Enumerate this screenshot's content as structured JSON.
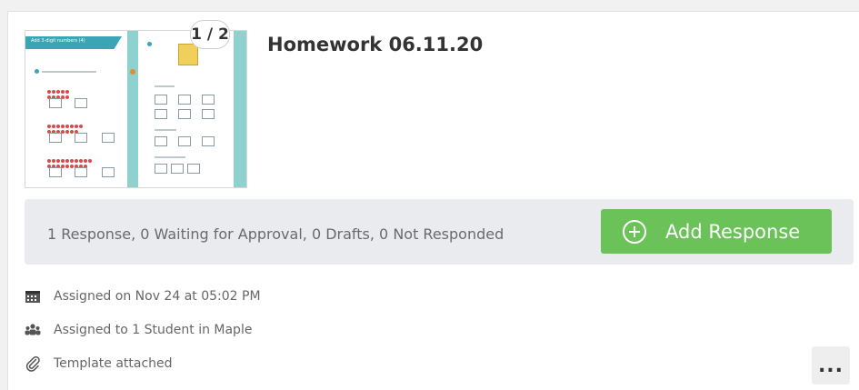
{
  "assignment": {
    "title": "Homework 06.11.20",
    "page_indicator": "1 / 2",
    "thumbnail": {
      "left_page_heading": "Add 3-digit numbers (4)"
    }
  },
  "status_bar": {
    "summary": "1 Response, 0 Waiting for Approval, 0 Drafts, 0 Not Responded",
    "add_response_label": "Add Response",
    "button_color": "#6ac259"
  },
  "meta": {
    "assigned_on": "Assigned on Nov 24 at 05:02 PM",
    "assigned_to": "Assigned to 1 Student in Maple",
    "template": "Template attached"
  },
  "icons": {
    "calendar": "calendar-icon",
    "students": "students-icon",
    "attachment": "paperclip-icon",
    "add": "plus-circle-icon",
    "more": "more-options-icon"
  },
  "more_label": "..."
}
